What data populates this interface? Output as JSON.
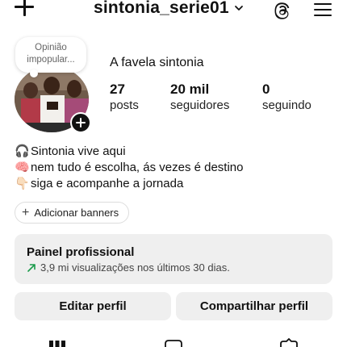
{
  "header": {
    "username": "sintonia_serie01",
    "new_post_icon": "plus-icon",
    "switch_account_icon": "chevron-down-icon",
    "threads_icon": "threads-icon",
    "menu_icon": "hamburger-menu-icon"
  },
  "note": {
    "text_line1": "Opinião",
    "text_line2": "impopular..."
  },
  "profile": {
    "name": "A favela sintonia",
    "avatar_icon": "profile-photo",
    "add_story_icon": "plus-icon"
  },
  "stats": [
    {
      "value": "27",
      "label": "posts"
    },
    {
      "value": "20 mil",
      "label": "seguidores"
    },
    {
      "value": "0",
      "label": "seguindo"
    }
  ],
  "bio": [
    {
      "emoji": "🎧",
      "text": "Sintonia vive aqui"
    },
    {
      "emoji": "🧠",
      "text": " nem tudo é escolha, ás vezes é destino"
    },
    {
      "emoji": "👇🏻",
      "text": "siga e acompanhe a jornada"
    }
  ],
  "banners": {
    "icon": "+",
    "label": "Adicionar banners"
  },
  "pro_panel": {
    "title": "Painel profissional",
    "trend_icon": "trending-up-icon",
    "subtitle": "3,9 mi visualizações nos últimos 30 dias."
  },
  "actions": {
    "edit_label": "Editar perfil",
    "share_label": "Compartilhar perfil"
  },
  "tabs": [
    {
      "icon": "grid-icon"
    },
    {
      "icon": "reels-icon"
    },
    {
      "icon": "tagged-icon"
    }
  ],
  "colors": {
    "panel_bg": "#efefef",
    "text_primary": "#111111",
    "text_secondary": "#444444"
  }
}
